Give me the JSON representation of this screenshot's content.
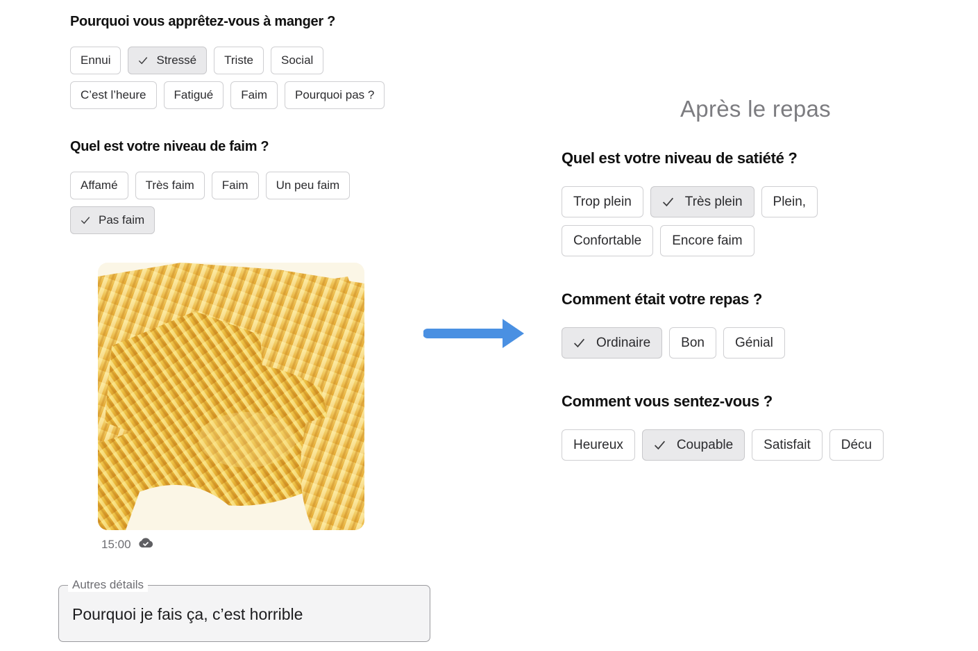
{
  "before_meal": {
    "reason": {
      "question": "Pourquoi vous apprêtez-vous à manger ?",
      "options": [
        {
          "label": "Ennui",
          "selected": false
        },
        {
          "label": "Stressé",
          "selected": true
        },
        {
          "label": "Triste",
          "selected": false
        },
        {
          "label": "Social",
          "selected": false
        },
        {
          "label": "C’est l’heure",
          "selected": false
        },
        {
          "label": "Fatigué",
          "selected": false
        },
        {
          "label": "Faim",
          "selected": false
        },
        {
          "label": "Pourquoi pas ?",
          "selected": false
        }
      ]
    },
    "hunger": {
      "question": "Quel est votre niveau de faim ?",
      "options": [
        {
          "label": "Affamé",
          "selected": false
        },
        {
          "label": "Très faim",
          "selected": false
        },
        {
          "label": "Faim",
          "selected": false
        },
        {
          "label": "Un peu faim",
          "selected": false
        },
        {
          "label": "Pas faim",
          "selected": true
        }
      ]
    },
    "photo": {
      "time": "15:00",
      "sync_icon": "cloud-check-icon"
    },
    "details": {
      "label": "Autres détails",
      "value": "Pourquoi je fais ça, c’est horrible"
    }
  },
  "arrow": {
    "icon": "arrow-right-icon",
    "color": "#4a90e2"
  },
  "after_meal": {
    "title": "Après le repas",
    "satiety": {
      "question": "Quel est votre niveau de satiété ?",
      "options": [
        {
          "label": "Trop plein",
          "selected": false
        },
        {
          "label": "Très plein",
          "selected": true
        },
        {
          "label": "Plein,",
          "selected": false
        },
        {
          "label": "Confortable",
          "selected": false
        },
        {
          "label": "Encore faim",
          "selected": false
        }
      ]
    },
    "meal": {
      "question": "Comment était votre repas ?",
      "options": [
        {
          "label": "Ordinaire",
          "selected": true
        },
        {
          "label": "Bon",
          "selected": false
        },
        {
          "label": "Génial",
          "selected": false
        }
      ]
    },
    "feeling": {
      "question": "Comment vous sentez-vous ?",
      "options": [
        {
          "label": "Heureux",
          "selected": false
        },
        {
          "label": "Coupable",
          "selected": true
        },
        {
          "label": "Satisfait",
          "selected": false
        },
        {
          "label": "Décu",
          "selected": false
        }
      ]
    }
  },
  "colors": {
    "selected_chip_bg": "#e9e9eb",
    "chip_border": "#cfcfd2"
  }
}
